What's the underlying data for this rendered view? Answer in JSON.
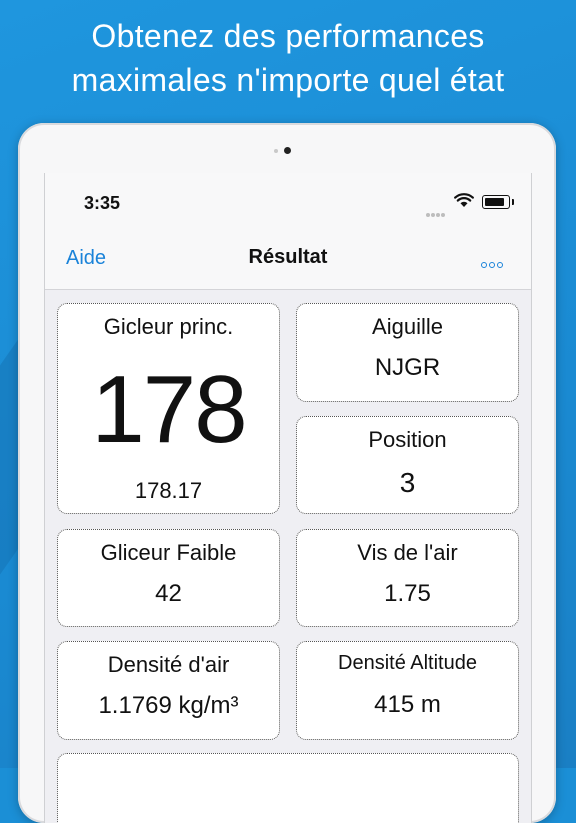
{
  "headline": {
    "line1": "Obtenez des performances",
    "line2": "maximales n'importe quel état"
  },
  "status_bar": {
    "time": "3:35"
  },
  "nav": {
    "left_label": "Aide",
    "title": "Résultat",
    "more_icon": "ellipsis-icon"
  },
  "cards": {
    "main_jet": {
      "label": "Gicleur princ.",
      "value": "178",
      "exact": "178.17"
    },
    "needle": {
      "label": "Aiguille",
      "value": "NJGR"
    },
    "position": {
      "label": "Position",
      "value": "3"
    },
    "pilot_jet": {
      "label": "Gliceur Faible",
      "value": "42"
    },
    "air_screw": {
      "label": "Vis de l'air",
      "value": "1.75"
    },
    "air_density": {
      "label": "Densité d'air",
      "value": "1.1769 kg/m³"
    },
    "density_altitude": {
      "label": "Densité Altitude",
      "value": "415 m"
    }
  },
  "colors": {
    "background": "#1b8fd6",
    "accent": "#1a83d9"
  }
}
